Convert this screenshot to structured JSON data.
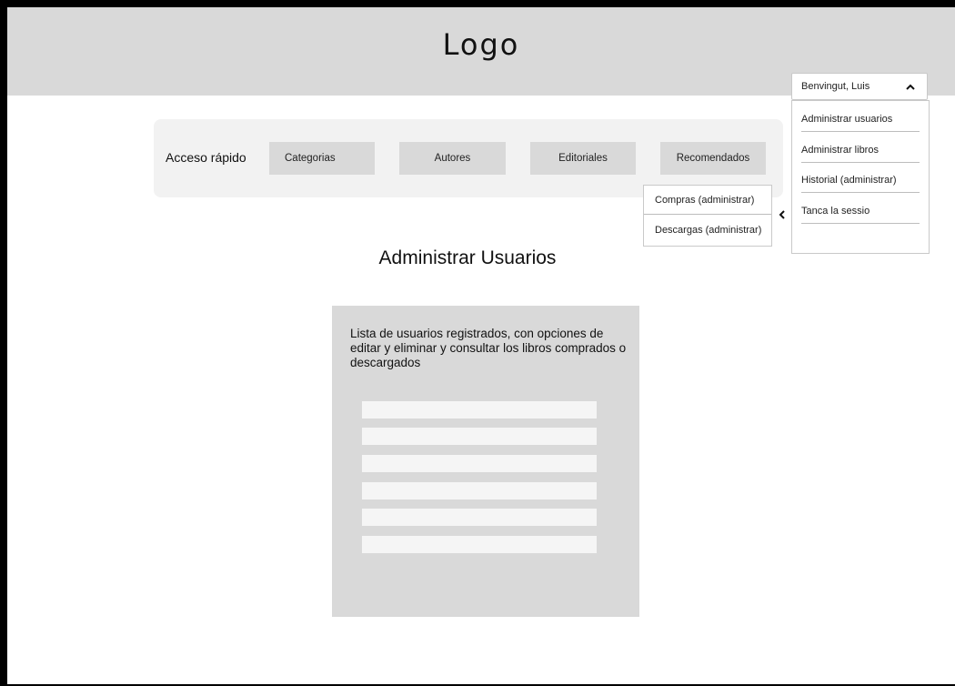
{
  "header": {
    "logo": "Logo"
  },
  "user_menu": {
    "user_name": "Benvingut, Luis",
    "items": [
      {
        "label": "Administrar usuarios"
      },
      {
        "label": "Administrar libros"
      },
      {
        "label": "Historial (administrar)"
      },
      {
        "label": "Tanca la sessio"
      }
    ]
  },
  "quick_access": {
    "label": "Acceso rápido",
    "buttons": [
      {
        "label": "Categorias"
      },
      {
        "label": "Autores"
      },
      {
        "label": "Editoriales"
      },
      {
        "label": "Recomendados"
      }
    ],
    "submenu": [
      {
        "label": "Compras (administrar)"
      },
      {
        "label": "Descargas (administrar)"
      }
    ]
  },
  "main": {
    "title": "Administrar Usuarios",
    "description": "Lista de usuarios registrados, con opciones de editar y eliminar y consultar los libros comprados o descargados",
    "user_rows": [
      {
        "text": ""
      },
      {
        "text": ""
      },
      {
        "text": ""
      },
      {
        "text": ""
      },
      {
        "text": ""
      },
      {
        "text": ""
      }
    ]
  },
  "icons": {
    "dropdown_toggle": "chevron-up-icon",
    "submenu_back": "chevron-left-icon"
  },
  "colors": {
    "header_bg": "#d9d9d9",
    "quick_bar_bg": "#f2f2f2",
    "button_bg": "#d9d9d9",
    "panel_bg": "#d9d9d9",
    "row_bg": "#f5f5f5"
  }
}
